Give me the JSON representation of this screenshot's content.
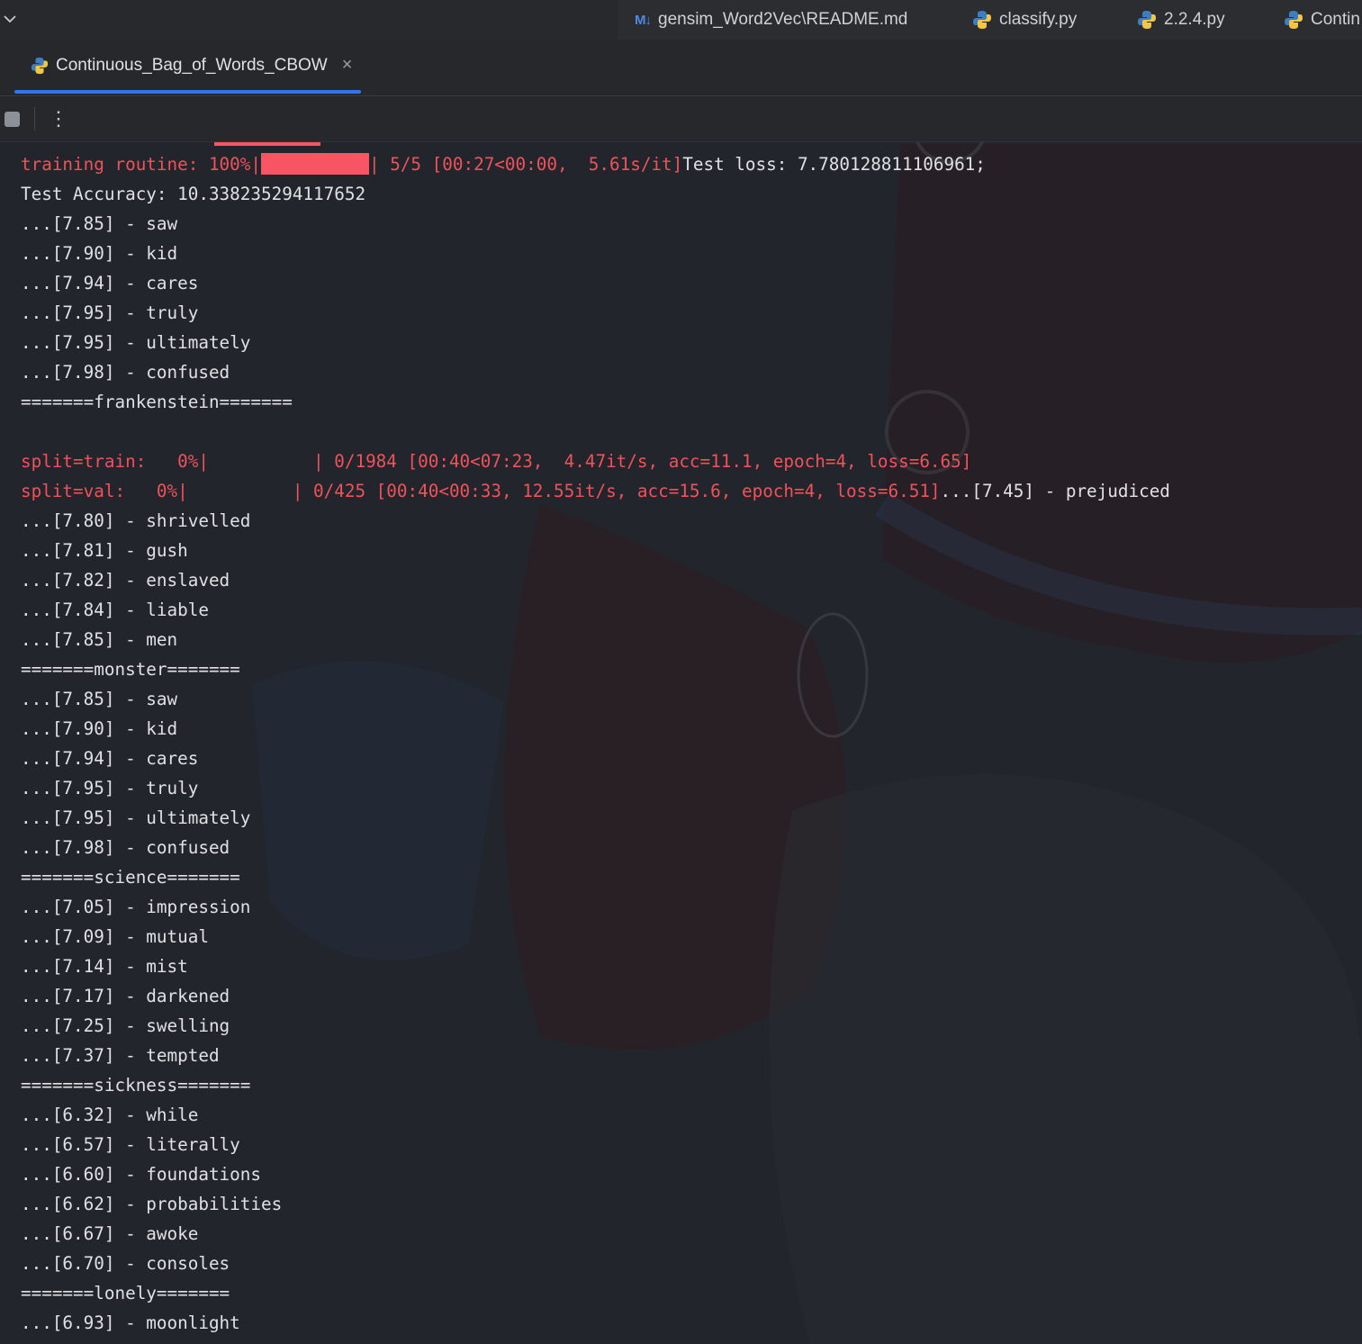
{
  "editor_tabs": [
    {
      "icon": "markdown",
      "label": "gensim_Word2Vec\\README.md"
    },
    {
      "icon": "python",
      "label": "classify.py"
    },
    {
      "icon": "python",
      "label": "2.2.4.py"
    },
    {
      "icon": "python",
      "label": "Contin"
    }
  ],
  "md_badge": "M↓",
  "run_tab": {
    "label": "Continuous_Bag_of_Words_CBOW",
    "close": "×"
  },
  "toolbar": {
    "more": "⋮"
  },
  "console": {
    "training": {
      "prefix": "training routine: 100%|",
      "progress": 1.0,
      "suffix": "| 5/5 [00:27<00:00,  5.61s/it]",
      "tail": "Test loss: 7.780128811106961;"
    },
    "accuracy": "Test Accuracy: 10.338235294117652",
    "block1": [
      "...[7.85] - saw",
      "...[7.90] - kid",
      "...[7.94] - cares",
      "...[7.95] - truly",
      "...[7.95] - ultimately",
      "...[7.98] - confused",
      "=======frankenstein======="
    ],
    "split_train": "split=train:   0%|          | 0/1984 [00:40<07:23,  4.47it/s, acc=11.1, epoch=4, loss=6.65]",
    "split_val": "split=val:   0%|          | 0/425 [00:40<00:33, 12.55it/s, acc=15.6, epoch=4, loss=6.51]",
    "split_val_tail": "...[7.45] - prejudiced",
    "block2": [
      "...[7.80] - shrivelled",
      "...[7.81] - gush",
      "...[7.82] - enslaved",
      "...[7.84] - liable",
      "...[7.85] - men",
      "=======monster=======",
      "...[7.85] - saw",
      "...[7.90] - kid",
      "...[7.94] - cares",
      "...[7.95] - truly",
      "...[7.95] - ultimately",
      "...[7.98] - confused",
      "=======science=======",
      "...[7.05] - impression",
      "...[7.09] - mutual",
      "...[7.14] - mist",
      "...[7.17] - darkened",
      "...[7.25] - swelling",
      "...[7.37] - tempted",
      "=======sickness=======",
      "...[6.32] - while",
      "...[6.57] - literally",
      "...[6.60] - foundations",
      "...[6.62] - probabilities",
      "...[6.67] - awoke",
      "...[6.70] - consoles",
      "=======lonely=======",
      "...[6.93] - moonlight"
    ]
  },
  "colors": {
    "error_text": "#f0525b",
    "progress_fill": "#f75464",
    "tab_underline": "#3574f0",
    "text": "#dfe1e5"
  }
}
